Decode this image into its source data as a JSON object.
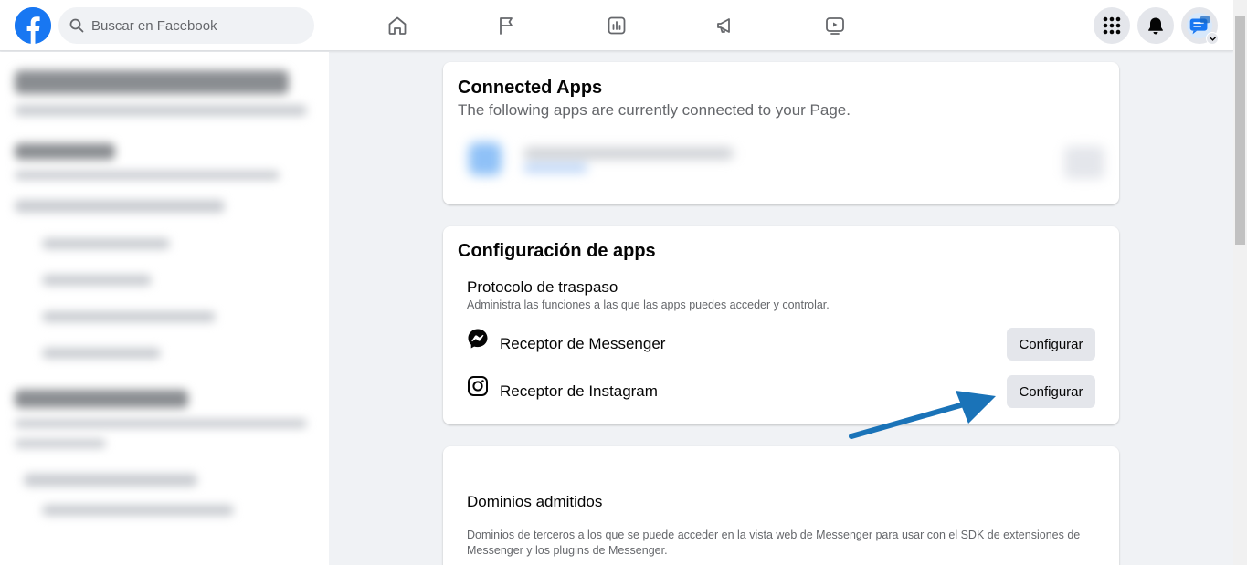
{
  "header": {
    "search_placeholder": "Buscar en Facebook",
    "brand_color": "#1877f2"
  },
  "nav": {
    "icons": [
      "home-icon",
      "flag-icon",
      "insights-icon",
      "megaphone-icon",
      "watch-icon"
    ]
  },
  "connected_apps": {
    "title": "Connected Apps",
    "subtitle": "The following apps are currently connected to your Page."
  },
  "app_settings": {
    "title": "Configuración de apps",
    "protocol_title": "Protocolo de traspaso",
    "protocol_desc": "Administra las funciones a las que las apps puedes acceder y controlar.",
    "rows": [
      {
        "label": "Receptor de Messenger",
        "icon": "messenger-icon",
        "button": "Configurar"
      },
      {
        "label": "Receptor de Instagram",
        "icon": "instagram-icon",
        "button": "Configurar"
      }
    ]
  },
  "domains": {
    "title": "Dominios admitidos",
    "desc": "Dominios de terceros a los que se puede acceder en la vista web de Messenger para usar con el SDK de extensiones de Messenger y los plugins de Messenger."
  },
  "annotation": {
    "arrow_color": "#1a73b8"
  }
}
